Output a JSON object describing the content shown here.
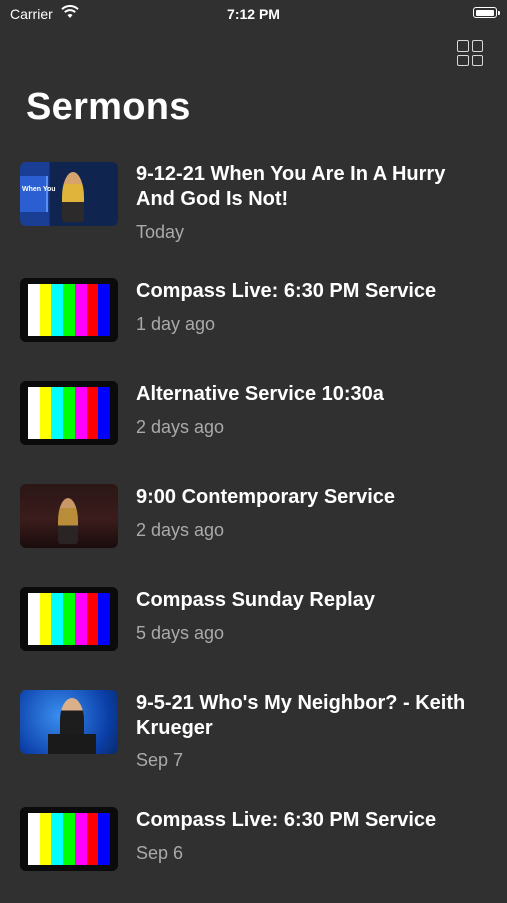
{
  "status_bar": {
    "carrier": "Carrier",
    "time": "7:12 PM"
  },
  "header": {
    "title": "Sermons",
    "layout_icon": "grid-icon"
  },
  "sermons": [
    {
      "title": "9-12-21 When You Are In A Hurry And God Is Not!",
      "date": "Today",
      "thumbnail": "sermon-photo",
      "slide_text": "When You"
    },
    {
      "title": "Compass Live: 6:30 PM Service",
      "date": "1 day ago",
      "thumbnail": "color-bars"
    },
    {
      "title": "Alternative Service 10:30a",
      "date": "2 days ago",
      "thumbnail": "color-bars"
    },
    {
      "title": "9:00 Contemporary Service",
      "date": "2 days ago",
      "thumbnail": "sermon-photo"
    },
    {
      "title": "Compass Sunday Replay",
      "date": "5 days ago",
      "thumbnail": "color-bars"
    },
    {
      "title": "9-5-21 Who's My Neighbor? - Keith Krueger",
      "date": "Sep 7",
      "thumbnail": "sermon-photo"
    },
    {
      "title": "Compass Live: 6:30 PM Service",
      "date": "Sep 6",
      "thumbnail": "color-bars"
    }
  ],
  "colors": {
    "background": "#303030",
    "secondary_text": "#aaaaaa"
  },
  "color_bars": [
    "#ffffff",
    "#ffff00",
    "#00ffff",
    "#00ff00",
    "#ff00ff",
    "#ff0000",
    "#0000ff"
  ]
}
